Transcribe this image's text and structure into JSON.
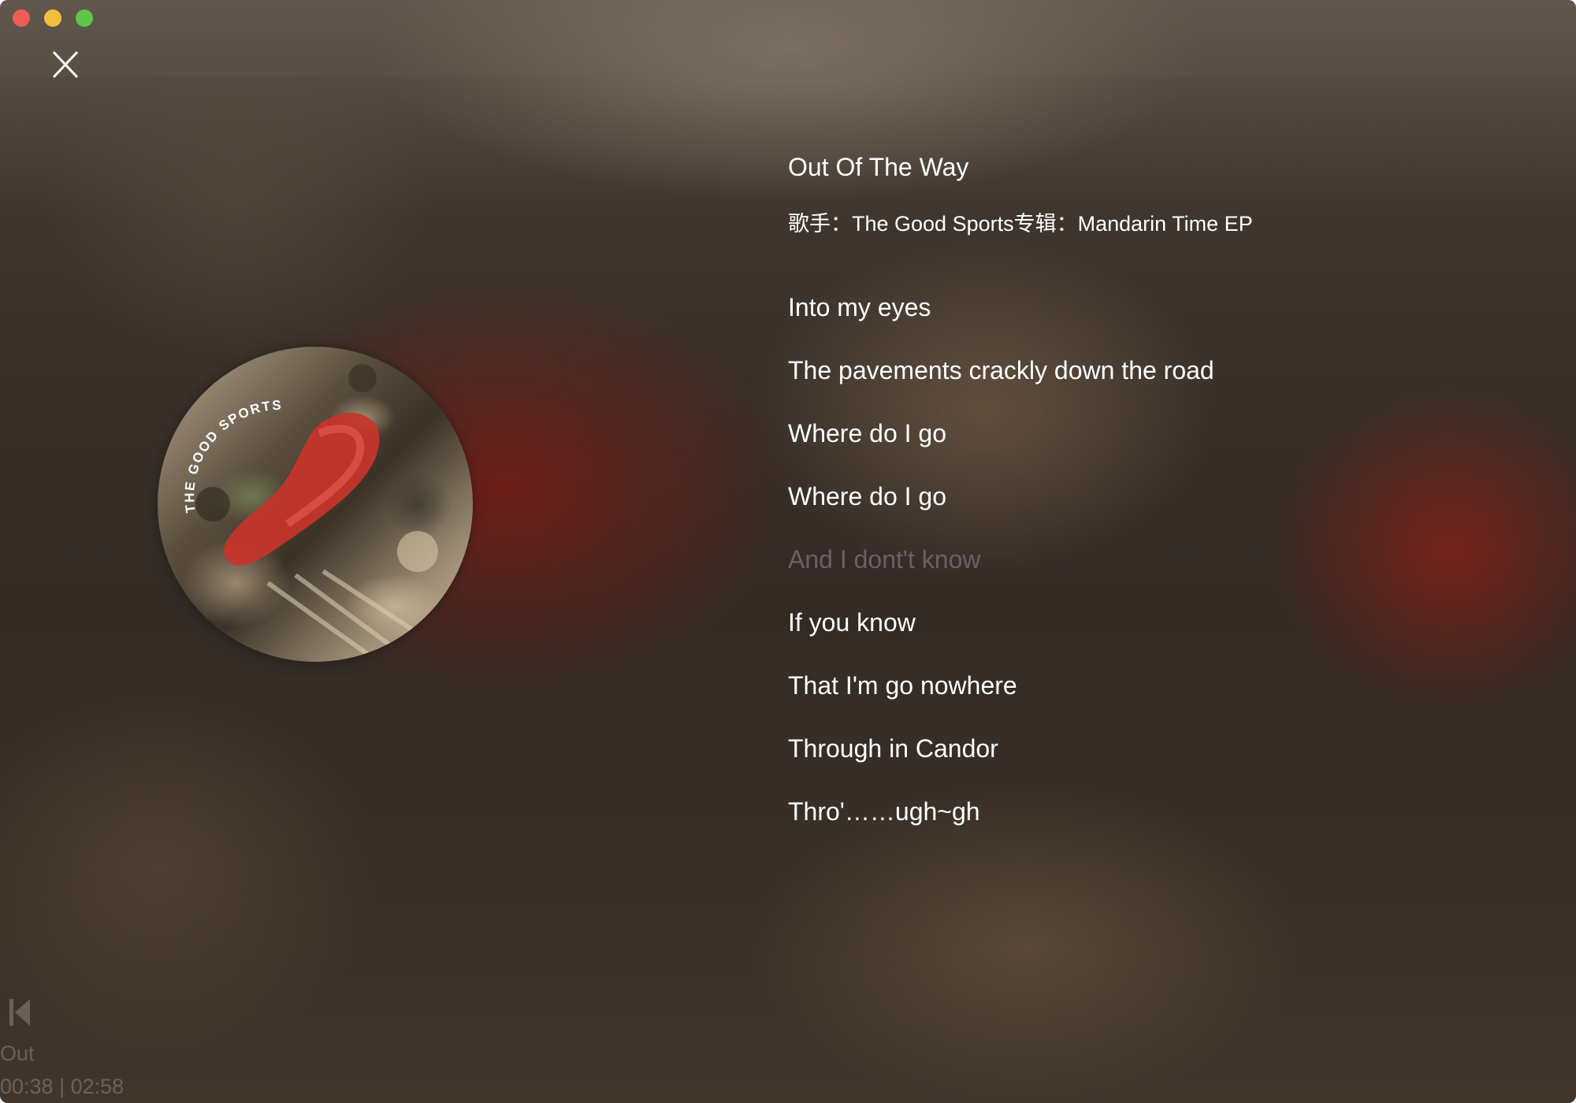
{
  "window": {
    "traffic_lights": {
      "close_color": "#ee5d55",
      "minimize_color": "#f5be3f",
      "maximize_color": "#5ec748"
    },
    "close_icon": "close-icon"
  },
  "song": {
    "title": "Out Of The Way",
    "meta": "歌手：The Good Sports专辑：Mandarin Time EP"
  },
  "album_art": {
    "artist_text": "THE GOOD SPORTS"
  },
  "lyrics": {
    "active_index": 4,
    "active_color": "#6e5e66",
    "lines": [
      "Into my eyes",
      "The pavements crackly down the road",
      "Where do I go",
      "Where do I go",
      "And I dont't know",
      "If you know",
      "That I'm go nowhere",
      "Through in Candor",
      "Thro'……ugh~gh"
    ]
  },
  "mini_player": {
    "prev_icon": "previous-icon",
    "title": "Out",
    "time": "00:38 | 02:58"
  }
}
